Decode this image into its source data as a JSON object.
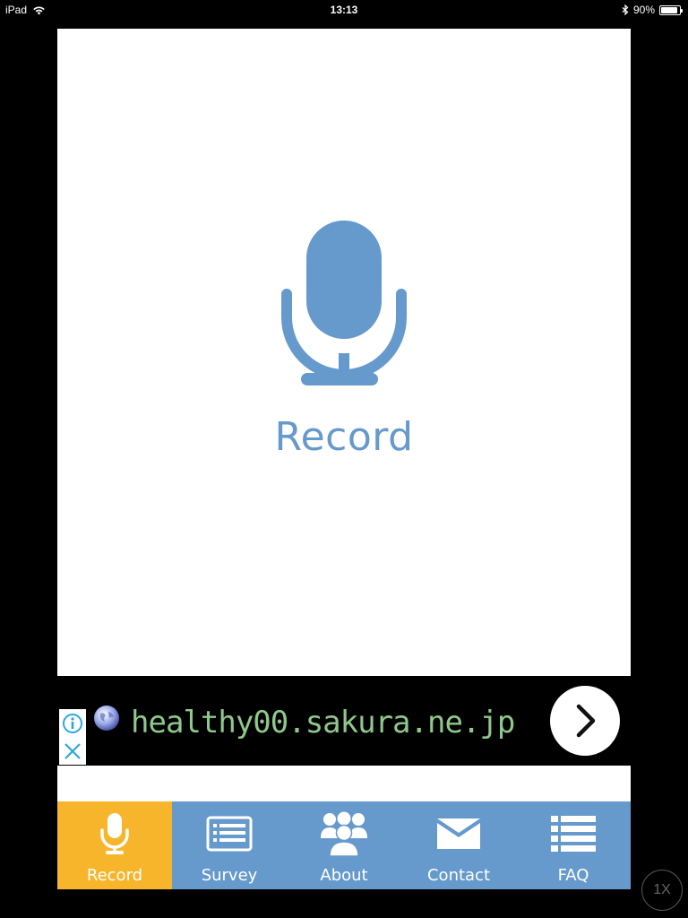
{
  "status_bar": {
    "device": "iPad",
    "time": "13:13",
    "battery": "90%",
    "battery_level": 0.9
  },
  "main": {
    "record_label": "Record",
    "mic_icon": "microphone-icon",
    "accent_color": "#6699cc"
  },
  "ad": {
    "url_text": "healthy00.sakura.ne.jp",
    "icons": [
      "info-icon",
      "close-icon",
      "globe-icon",
      "chevron-right-icon"
    ]
  },
  "tabs": [
    {
      "label": "Record",
      "icon": "microphone-icon",
      "active": true
    },
    {
      "label": "Survey",
      "icon": "survey-form-icon",
      "active": false
    },
    {
      "label": "About",
      "icon": "group-icon",
      "active": false
    },
    {
      "label": "Contact",
      "icon": "envelope-icon",
      "active": false
    },
    {
      "label": "FAQ",
      "icon": "list-icon",
      "active": false
    }
  ],
  "tab_colors": {
    "active": "#f7b52c",
    "inactive": "#6699cc"
  },
  "zoom_label": "1X"
}
